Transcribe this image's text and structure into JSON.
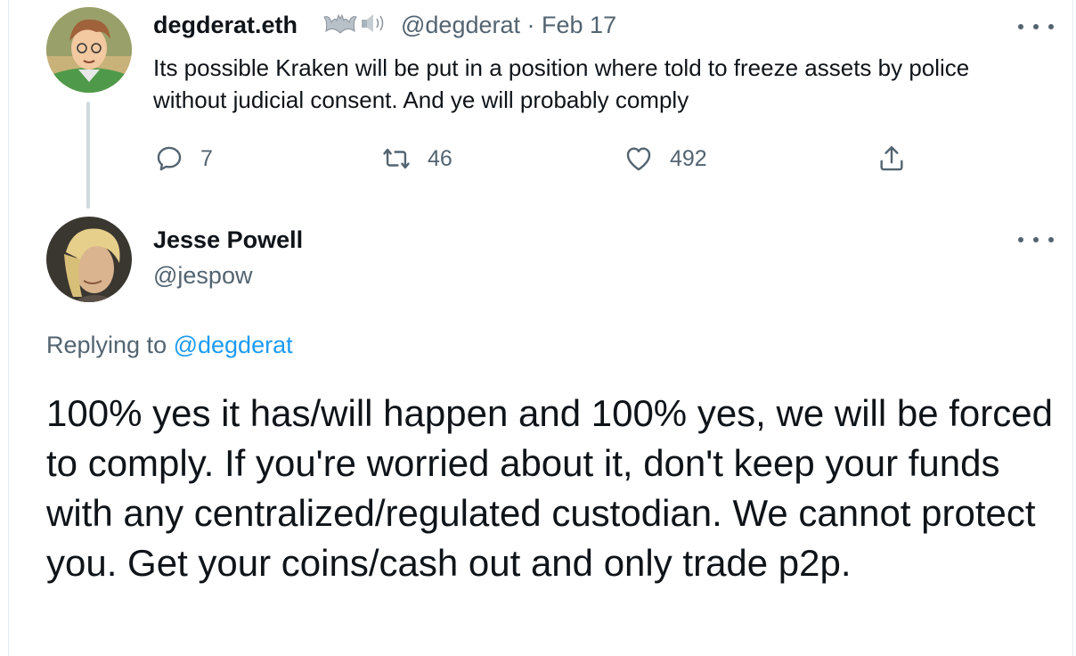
{
  "tweet1": {
    "display_name": "degderat.eth",
    "handle": "@degderat",
    "separator": "·",
    "date": "Feb 17",
    "text": "Its possible Kraken will be put in a position where told to freeze assets by police without judicial consent. And ye will probably comply",
    "badges": [
      "bat-icon",
      "speaker-icon"
    ],
    "actions": {
      "replies": "7",
      "retweets": "46",
      "likes": "492"
    }
  },
  "tweet2": {
    "display_name": "Jesse Powell",
    "handle": "@jespow",
    "replying_prefix": "Replying to ",
    "replying_handle": "@degderat",
    "text": "100% yes it has/will happen and 100% yes, we will be forced to comply. If you're worried about it, don't keep your funds with any centralized/regulated custodian. We cannot protect you. Get your coins/cash out and only trade p2p."
  },
  "colors": {
    "text": "#0f1419",
    "muted": "#536471",
    "link": "#1d9bf0",
    "thread_line": "#cfd9de"
  }
}
